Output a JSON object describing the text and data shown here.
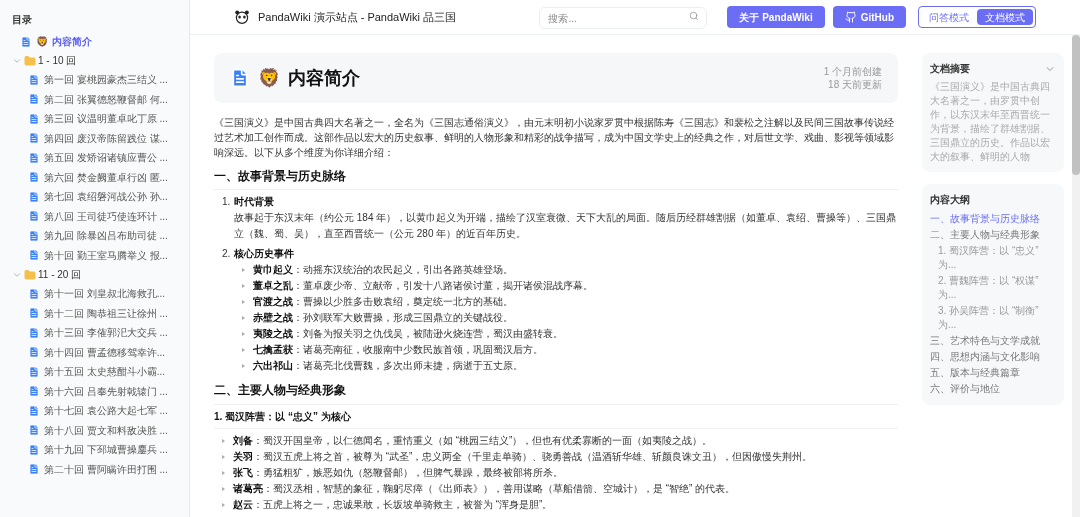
{
  "sidebar": {
    "title": "目录",
    "items": [
      {
        "kind": "doc",
        "emoji": "🦁",
        "label": "内容简介",
        "selected": true
      },
      {
        "kind": "folder",
        "label": "1 - 10 回",
        "expanded": true,
        "children": [
          {
            "label": "第一回 宴桃园豪杰三结义 ...",
            "selected": false
          },
          {
            "label": "第二回 张翼德怒鞭督邮 何...",
            "selected": false
          },
          {
            "label": "第三回 议温明董卓叱丁原 ...",
            "selected": false
          },
          {
            "label": "第四回 废汉帝陈留践位 谋...",
            "selected": false
          },
          {
            "label": "第五回 发矫诏诸镇应曹公 ...",
            "selected": false
          },
          {
            "label": "第六回 焚金阙董卓行凶 匿...",
            "selected": false
          },
          {
            "label": "第七回 袁绍磐河战公孙 孙...",
            "selected": false
          },
          {
            "label": "第八回 王司徒巧使连环计 ...",
            "selected": false
          },
          {
            "label": "第九回 除暴凶吕布助司徒 ...",
            "selected": false
          },
          {
            "label": "第十回 勤王室马腾举义 报...",
            "selected": false
          }
        ]
      },
      {
        "kind": "folder",
        "label": "11 - 20 回",
        "expanded": true,
        "children": [
          {
            "label": "第十一回 刘皇叔北海救孔...",
            "selected": false
          },
          {
            "label": "第十二回 陶恭祖三让徐州 ...",
            "selected": false
          },
          {
            "label": "第十三回 李傕郭汜大交兵 ...",
            "selected": false
          },
          {
            "label": "第十四回 曹孟德移驾幸许...",
            "selected": false
          },
          {
            "label": "第十五回 太史慈酣斗小霸...",
            "selected": false
          },
          {
            "label": "第十六回 吕奉先射戟辕门 ...",
            "selected": false
          },
          {
            "label": "第十七回 袁公路大起七军 ...",
            "selected": false
          },
          {
            "label": "第十八回 贾文和料敌决胜 ...",
            "selected": false
          },
          {
            "label": "第十九回 下邳城曹操鏖兵 ...",
            "selected": false
          },
          {
            "label": "第二十回 曹阿瞒许田打围 ...",
            "selected": false
          }
        ]
      }
    ]
  },
  "header": {
    "site_title": "PandaWiki 演示站点 - PandaWiki 品三国",
    "search": {
      "placeholder": "搜索..."
    },
    "buttons": [
      {
        "kind": "about",
        "label": "关于 PandaWiki"
      },
      {
        "kind": "github",
        "label": "GitHub"
      }
    ],
    "modes": [
      {
        "label": "问答模式",
        "selected": false
      },
      {
        "label": "文档模式",
        "selected": true
      }
    ]
  },
  "article": {
    "emoji": "🦁",
    "title": "内容简介",
    "created": "1 个月前创建",
    "updated": "18 天前更新",
    "intro": "《三国演义》是中国古典四大名著之一，全名为《三国志通俗演义》，由元末明初小说家罗贯中根据陈寿《三国志》和裴松之注解以及民间三国故事传说经过艺术加工创作而成。这部作品以宏大的历史叙事、鲜明的人物形象和精彩的战争描写，成为中国文学史上的经典之作，对后世文学、戏曲、影视等领域影响深远。以下从多个维度为你详细介绍：",
    "sections": [
      {
        "heading": "一、故事背景与历史脉络",
        "blocks": [
          {
            "kind": "numbered",
            "number": "1.",
            "title": "时代背景",
            "text": "故事起于东汉末年（约公元 184 年），以黄巾起义为开端，描绘了汉室衰微、天下大乱的局面。随后历经群雄割据（如董卓、袁绍、曹操等）、三国鼎立（魏、蜀、吴），直至西晋统一（公元 280 年）的近百年历史。"
          },
          {
            "kind": "numbered",
            "number": "2.",
            "title": "核心历史事件",
            "items": [
              "**黄巾起义**：动摇东汉统治的农民起义，引出各路英雄登场。",
              "**董卓之乱**：董卓废少帝、立献帝，引发十八路诸侯讨董，揭开诸侯混战序幕。",
              "**官渡之战**：曹操以少胜多击败袁绍，奠定统一北方的基础。",
              "**赤壁之战**：孙刘联军大败曹操，形成三国鼎立的关键战役。",
              "**夷陵之战**：刘备为报关羽之仇伐吴，被陆逊火烧连营，蜀汉由盛转衰。",
              "**七擒孟获**：诸葛亮南征，收服南中少数民族首领，巩固蜀汉后方。",
              "**六出祁山**：诸葛亮北伐曹魏，多次出师未捷，病逝于五丈原。"
            ]
          }
        ]
      },
      {
        "heading": "二、主要人物与经典形象",
        "blocks": [
          {
            "kind": "subheading",
            "title": "1. 蜀汉阵营：以 “忠义” 为核心",
            "items": [
              "**刘备**：蜀汉开国皇帝，以仁德闻名，重情重义（如 “桃园三结义”），但也有优柔寡断的一面（如夷陵之战）。",
              "**关羽**：蜀汉五虎上将之首，被尊为 “武圣”，忠义两全（千里走单骑）、骁勇善战（温酒斩华雄、斩颜良诛文丑），但因傲慢失荆州。",
              "**张飞**：勇猛粗犷，嫉恶如仇（怒鞭督邮），但脾气暴躁，最终被部将所杀。",
              "**诸葛亮**：蜀汉丞相，智慧的象征，鞠躬尽瘁（《出师表》），善用谋略（草船借箭、空城计），是 “智绝” 的代表。",
              "**赵云**：五虎上将之一，忠诚果敢，长坂坡单骑救主，被誉为 “浑身是胆”。"
            ]
          }
        ]
      }
    ]
  },
  "summary": {
    "title": "文档摘要",
    "expanded": true,
    "text": "《三国演义》是中国古典四大名著之一，由罗贯中创作，以东汉末年至西晋统一为背景，描绘了群雄割据、三国鼎立的历史。作品以宏大的叙事、鲜明的人物"
  },
  "outline": {
    "title": "内容大纲",
    "items": [
      {
        "label": "一、故事背景与历史脉络",
        "selected": true
      },
      {
        "label": "二、主要人物与经典形象",
        "selected": false,
        "children": [
          {
            "label": "1. 蜀汉阵营：以 “忠义” 为...",
            "selected": false
          },
          {
            "label": "2. 曹魏阵营：以 “权谋” 为...",
            "selected": false
          },
          {
            "label": "3. 孙吴阵营：以 “制衡” 为...",
            "selected": false
          }
        ]
      },
      {
        "label": "三、艺术特色与文学成就",
        "selected": false
      },
      {
        "label": "四、思想内涵与文化影响",
        "selected": false
      },
      {
        "label": "五、版本与经典篇章",
        "selected": false
      },
      {
        "label": "六、评价与地位",
        "selected": false
      }
    ]
  }
}
